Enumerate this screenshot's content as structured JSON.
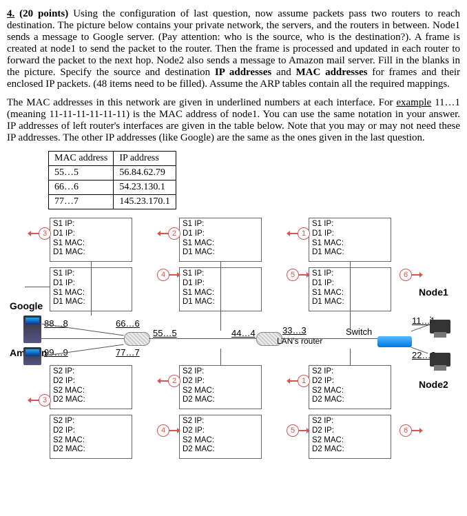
{
  "question": {
    "number": "4.",
    "points": "(20 points)",
    "p1": "Using the configuration of last question, now assume packets pass two routers to reach destination. The picture below contains your private network, the servers, and the routers in between. Node1 sends a message to Google server. (Pay attention: who is the source, who is the destination?). A frame is created at node1 to send the packet to the router. Then the frame is processed and updated in each router to forward the packet to the next hop. Node2 also sends a message to Amazon mail server. Fill in the blanks in the picture. Specify the source and destination",
    "p1b": "IP addresses",
    "p1c": "and",
    "p1d": "MAC addresses",
    "p1e": "for frames and their enclosed IP packets. (48 items need to be filled). Assume the ARP tables contain all the required mappings.",
    "p2a": "The MAC addresses in this network are given in underlined numbers at each interface. For",
    "example_word": "example",
    "example_val": "11…1",
    "p2b": "(meaning 11-11-11-11-11-11) is the MAC address of node1. You can use the same notation in your answer. IP addresses of left router's interfaces are given in the table below. Note that you may or may not need these IP addresses. The other IP addresses (like Google) are the same as the ones given in the last question."
  },
  "table": {
    "headers": [
      "MAC address",
      "IP address"
    ],
    "rows": [
      [
        "55…5",
        "56.84.62.79"
      ],
      [
        "66…6",
        "54.23.130.1"
      ],
      [
        "77…7",
        "145.23.170.1"
      ]
    ]
  },
  "labels": {
    "s1ip": "S1 IP:",
    "d1ip": "D1 IP:",
    "s1mac": "S1 MAC:",
    "d1mac": "D1 MAC:",
    "s2ip": "S2 IP:",
    "d2ip": "D2 IP:",
    "s2mac": "S2 MAC:",
    "d2mac": "D2 MAC:"
  },
  "diagram": {
    "nums": {
      "n1": "1",
      "n2": "2",
      "n3": "3",
      "n4": "4",
      "n5": "5",
      "n6": "6"
    },
    "macs": {
      "m88": "88…8",
      "m66": "66…6",
      "m55": "55…5",
      "m44": "44…4",
      "m33": "33…3",
      "m11": "11…1",
      "m99": "99…9",
      "m77": "77…7",
      "m22": "22…2"
    },
    "names": {
      "google": "Google",
      "amazon": "Amazon",
      "switch": "Switch",
      "lan": "LAN's router",
      "node1": "Node1",
      "node2": "Node2"
    }
  }
}
